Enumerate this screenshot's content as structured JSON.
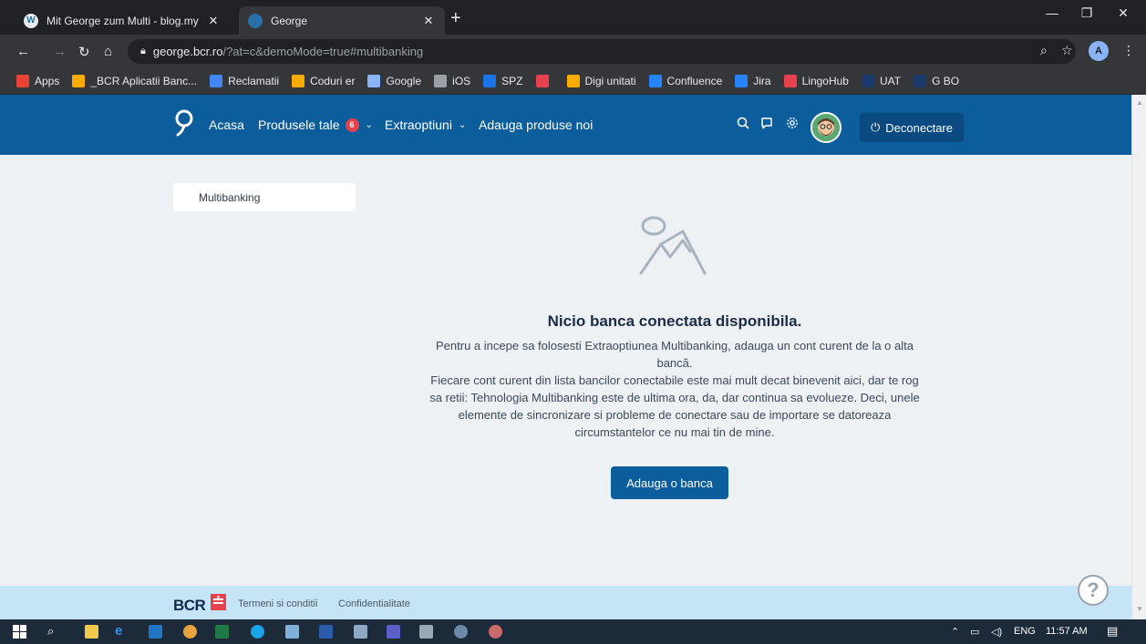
{
  "browser": {
    "tabs": [
      {
        "title": "Mit George zum Multi - blog.my",
        "favicon": "wordpress-icon",
        "active": false
      },
      {
        "title": "George",
        "favicon": "george-icon",
        "active": true
      }
    ],
    "new_tab": "+",
    "window_controls": {
      "minimize": "—",
      "restore": "❐",
      "close": "✕"
    },
    "url_host": "george.bcr.ro",
    "url_path": "/?at=c&demoMode=true#multibanking",
    "profile_initial": "A",
    "bookmarks": [
      {
        "label": "Apps",
        "color": "#ea4335"
      },
      {
        "label": "_BCR Aplicatii Banc...",
        "color": "#f9ab00"
      },
      {
        "label": "Reclamatii",
        "color": "#4285f4"
      },
      {
        "label": "Coduri er",
        "color": "#f9ab00"
      },
      {
        "label": "Google",
        "color": "#8ab4f8"
      },
      {
        "label": "iOS",
        "color": "#9aa0a6"
      },
      {
        "label": "SPZ",
        "color": "#1a73e8"
      },
      {
        "label": "",
        "color": "#e8414e"
      },
      {
        "label": "Digi unitati",
        "color": "#f9ab00"
      },
      {
        "label": "Confluence",
        "color": "#2684ff"
      },
      {
        "label": "Jira",
        "color": "#2684ff"
      },
      {
        "label": "LingoHub",
        "color": "#e8414e"
      },
      {
        "label": "UAT",
        "color": "#1a3a6a"
      },
      {
        "label": "G BO",
        "color": "#1a3a6a"
      }
    ]
  },
  "header": {
    "nav": {
      "home": "Acasa",
      "products": "Produsele tale",
      "products_badge": "6",
      "extras": "Extraoptiuni",
      "add_products": "Adauga produse noi"
    },
    "logout": "Deconectare",
    "colors": {
      "brand": "#0b5d9c",
      "badge": "#e8414e"
    }
  },
  "sidebar": {
    "selected": "Multibanking"
  },
  "empty_state": {
    "title": "Nicio banca conectata disponibila.",
    "line1": "Pentru a incepe sa folosesti Extraoptiunea Multibanking, adauga un cont curent de la o alta bancă.",
    "line2": "Fiecare cont curent din lista bancilor conectabile este mai mult decat binevenit aici, dar te rog sa retii: Tehnologia Multibanking este de ultima ora, da, dar continua sa evolueze. Deci, unele elemente de sincronizare si probleme de conectare sau de importare se datoreaza circumstantelor ce nu mai tin de mine.",
    "button": "Adauga o banca"
  },
  "footer": {
    "brand": "BCR",
    "terms": "Termeni si conditii",
    "privacy": "Confidentialitate",
    "help": "?"
  },
  "taskbar": {
    "language": "ENG",
    "time": "11:57 AM"
  }
}
